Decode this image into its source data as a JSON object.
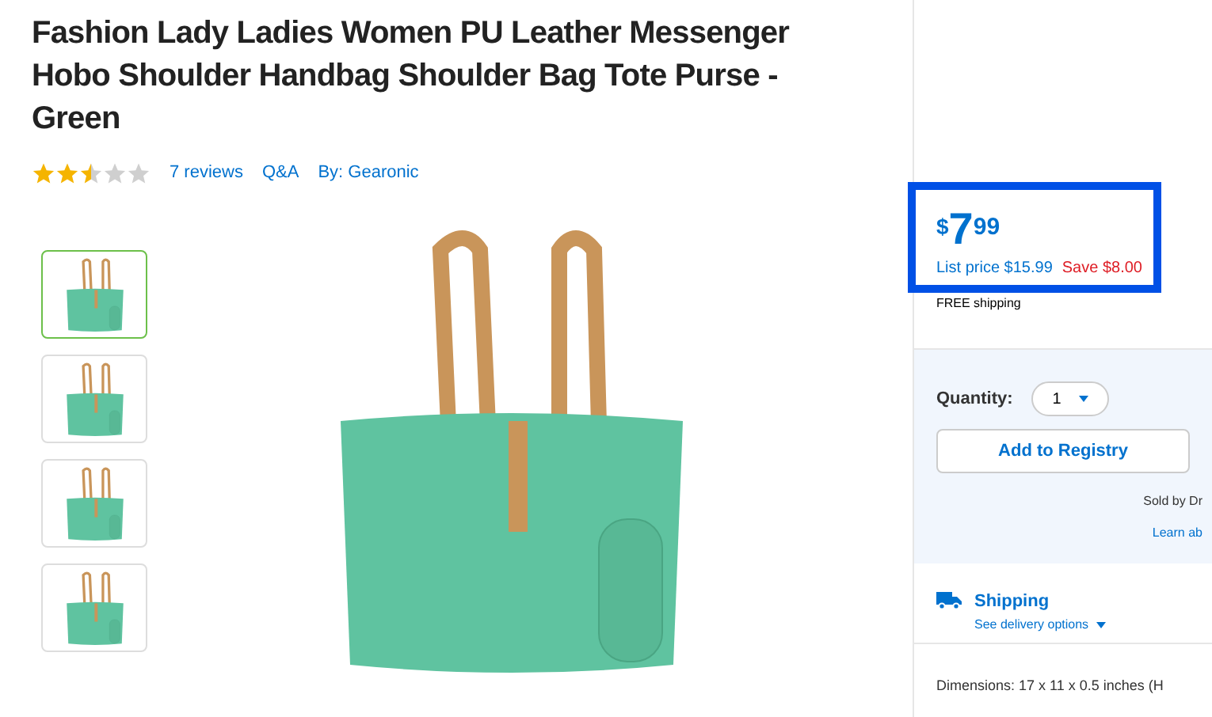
{
  "product": {
    "title": "Fashion Lady Ladies Women PU Leather Messenger Hobo Shoulder Handbag Shoulder Bag Tote Purse - Green",
    "stars": 2.5,
    "reviews": "7 reviews",
    "qa": "Q&A",
    "brand": "By: Gearonic"
  },
  "thumbnails": [
    {
      "selected": true
    },
    {
      "selected": false
    },
    {
      "selected": false
    },
    {
      "selected": false
    }
  ],
  "price": {
    "currency": "$",
    "whole": "7",
    "cents": "99",
    "list_price": "List price $15.99",
    "save": "Save $8.00",
    "shipping": "FREE shipping"
  },
  "quantity": {
    "label": "Quantity:",
    "value": "1"
  },
  "registry_button": "Add to Registry",
  "sold_by": "Sold by Dr",
  "learn": "Learn ab",
  "shipping": {
    "title": "Shipping",
    "link": "See delivery options"
  },
  "dimensions": "Dimensions: 17 x 11 x 0.5 inches (H"
}
